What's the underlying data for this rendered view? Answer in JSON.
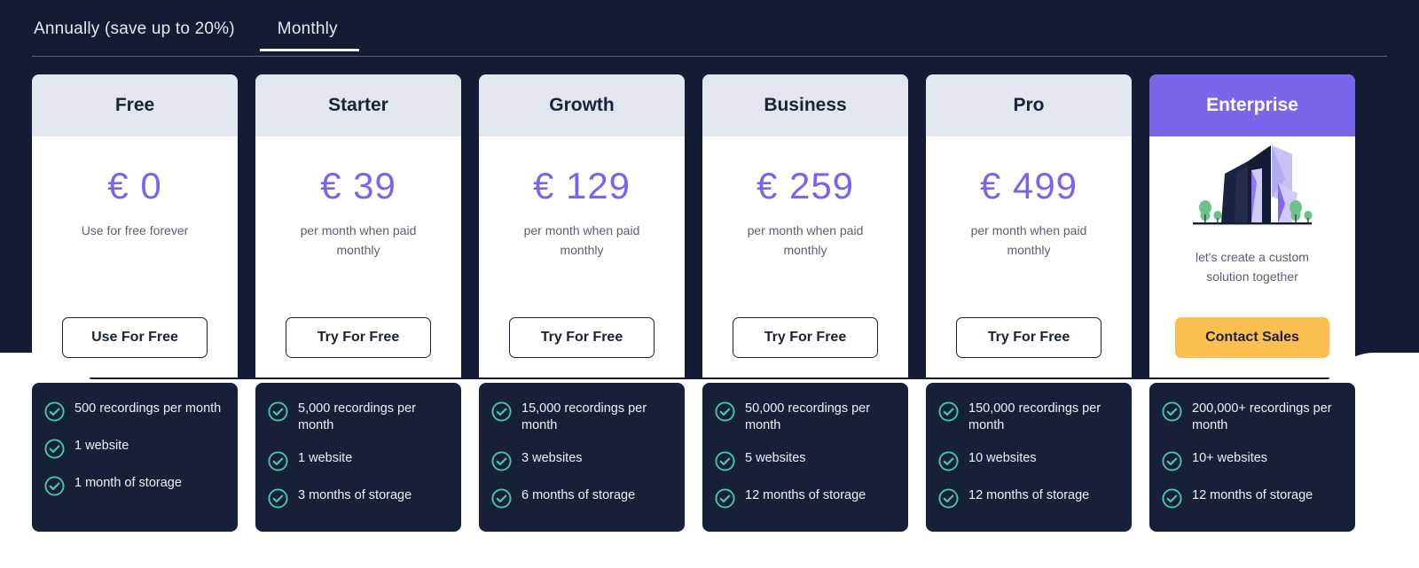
{
  "colors": {
    "page_background": "#ffffff",
    "dark_band": "#141b34",
    "card_header": "#e2e7ef",
    "enterprise_header": "#7a66e8",
    "price_purple": "#7b62ef",
    "features_panel": "#162039",
    "check_teal": "#49c5b1",
    "contact_sales_orange": "#fbbf4f"
  },
  "tabs": [
    {
      "label": "Annually (save up to 20%)",
      "active": false
    },
    {
      "label": "Monthly",
      "active": true
    }
  ],
  "plans": [
    {
      "name": "Free",
      "price": "€ 0",
      "price_note": "Use for free forever",
      "cta_label": "Use For Free",
      "cta_style": "outline",
      "highlighted": false,
      "features": [
        "500 recordings per month",
        "1 website",
        "1 month of storage"
      ]
    },
    {
      "name": "Starter",
      "price": "€ 39",
      "price_note": "per month when paid monthly",
      "cta_label": "Try For Free",
      "cta_style": "outline",
      "highlighted": false,
      "features": [
        "5,000 recordings per month",
        "1 website",
        "3 months of storage"
      ]
    },
    {
      "name": "Growth",
      "price": "€ 129",
      "price_note": "per month when paid monthly",
      "cta_label": "Try For Free",
      "cta_style": "outline",
      "highlighted": false,
      "features": [
        "15,000 recordings per month",
        "3 websites",
        "6 months of storage"
      ]
    },
    {
      "name": "Business",
      "price": "€ 259",
      "price_note": "per month when paid monthly",
      "cta_label": "Try For Free",
      "cta_style": "outline",
      "highlighted": false,
      "features": [
        "50,000 recordings per month",
        "5 websites",
        "12 months of storage"
      ]
    },
    {
      "name": "Pro",
      "price": "€ 499",
      "price_note": "per month when paid monthly",
      "cta_label": "Try For Free",
      "cta_style": "outline",
      "highlighted": false,
      "features": [
        "150,000 recordings per month",
        "10 websites",
        "12 months of storage"
      ]
    },
    {
      "name": "Enterprise",
      "price": null,
      "price_note": "let's create a custom solution together",
      "cta_label": "Contact Sales",
      "cta_style": "solid",
      "highlighted": true,
      "illustration": "office-buildings-illustration",
      "features": [
        "200,000+ recordings per month",
        "10+ websites",
        "12 months of storage"
      ]
    }
  ],
  "icons": {
    "check": "check-circle-icon"
  }
}
